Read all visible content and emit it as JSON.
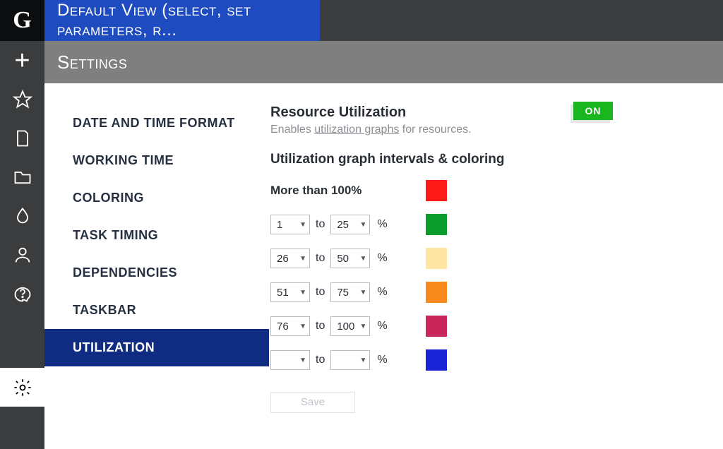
{
  "app_logo_letter": "G",
  "header": {
    "view_title": "Default View (select, set parameters, r...",
    "page_title": "Settings"
  },
  "tabs": [
    {
      "label": "DATE AND TIME FORMAT",
      "active": false
    },
    {
      "label": "WORKING TIME",
      "active": false
    },
    {
      "label": "COLORING",
      "active": false
    },
    {
      "label": "TASK TIMING",
      "active": false
    },
    {
      "label": "DEPENDENCIES",
      "active": false
    },
    {
      "label": "TASKBAR",
      "active": false
    },
    {
      "label": "UTILIZATION",
      "active": true
    }
  ],
  "panel": {
    "title": "Resource Utilization",
    "desc_prefix": "Enables ",
    "desc_link": "utilization graphs",
    "desc_suffix": " for resources.",
    "toggle_label": "ON",
    "subheading": "Utilization graph intervals & coloring",
    "more_than_label": "More than 100%",
    "more_than_color": "#ff1a1a",
    "to_word": "to",
    "percent_sign": "%",
    "save_label": "Save",
    "intervals": [
      {
        "from": "1",
        "to": "25",
        "color": "#0a9c2b"
      },
      {
        "from": "26",
        "to": "50",
        "color": "#ffe7a3"
      },
      {
        "from": "51",
        "to": "75",
        "color": "#f88a1d"
      },
      {
        "from": "76",
        "to": "100",
        "color": "#c9265b"
      },
      {
        "from": "",
        "to": "",
        "color": "#1a23d6"
      }
    ]
  },
  "rail_icons": [
    "plus-icon",
    "star-icon",
    "file-icon",
    "folder-icon",
    "drop-icon",
    "user-icon",
    "help-icon",
    "gear-icon"
  ]
}
